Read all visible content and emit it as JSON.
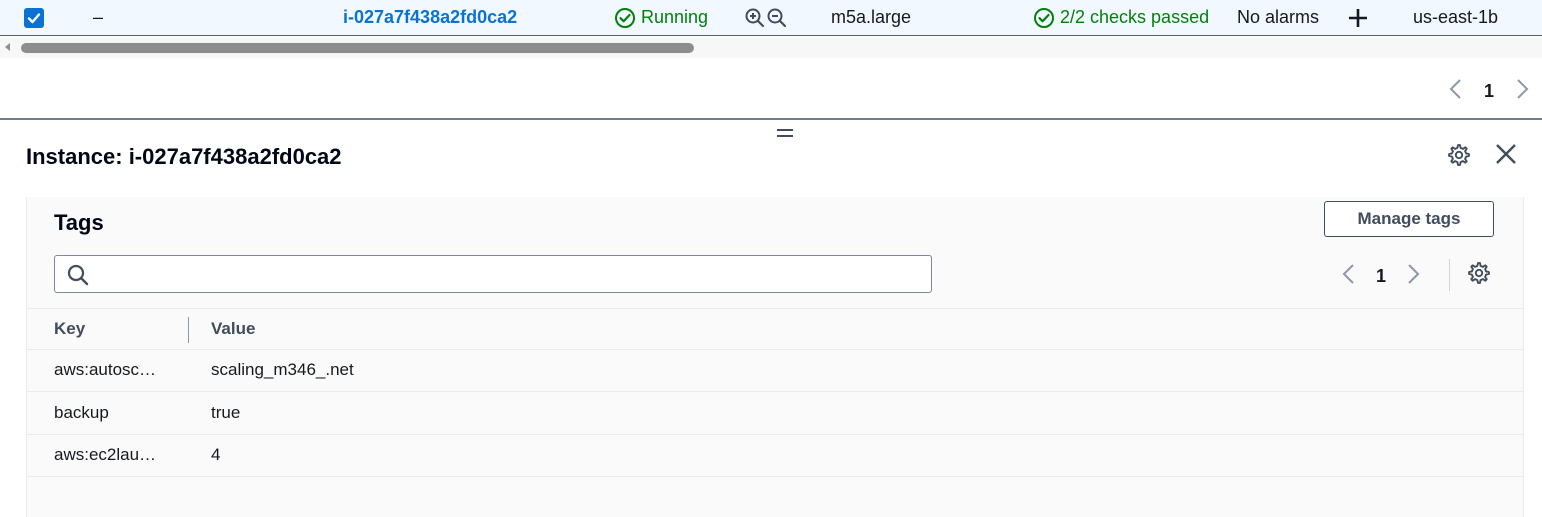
{
  "instance_row": {
    "name": "–",
    "instance_id": "i-027a7f438a2fd0ca2",
    "state": "Running",
    "instance_type": "m5a.large",
    "status_check": "2/2 checks passed",
    "alarm_status": "No alarms",
    "availability_zone": "us-east-1b"
  },
  "top_pagination": {
    "page": "1"
  },
  "panel": {
    "title": "Instance: i-027a7f438a2fd0ca2"
  },
  "tags": {
    "title": "Tags",
    "manage_label": "Manage tags",
    "search_placeholder": "",
    "page": "1",
    "columns": {
      "key": "Key",
      "value": "Value"
    },
    "rows": [
      {
        "key": "aws:autosc…",
        "value": "scaling_m346_.net"
      },
      {
        "key": "backup",
        "value": "true"
      },
      {
        "key": "aws:ec2lau…",
        "value": "4"
      }
    ]
  },
  "colors": {
    "link": "#0972d3",
    "success": "#037f0c",
    "selected_row_bg": "#f1f8ff"
  },
  "icons": [
    "checkbox-checked-icon",
    "running-status-icon",
    "zoom-in-icon",
    "zoom-out-icon",
    "checks-passed-icon",
    "plus-icon",
    "chevron-left-icon",
    "chevron-right-icon",
    "settings-icon",
    "close-icon",
    "search-icon",
    "drag-handle-icon"
  ]
}
